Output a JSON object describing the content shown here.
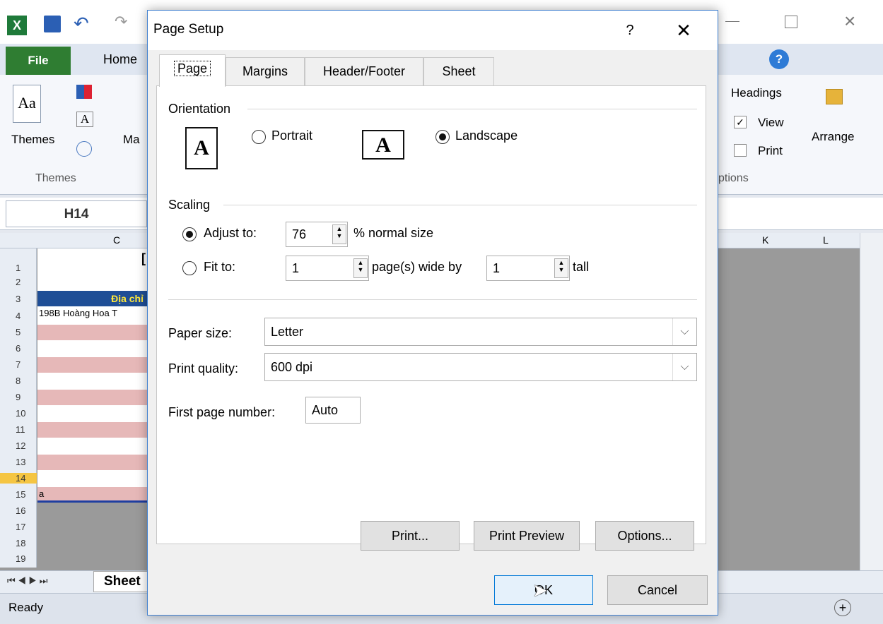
{
  "excel": {
    "file_tab": "File",
    "home_tab": "Home",
    "themes_button": "Themes",
    "themes_group": "Themes",
    "margins_partial": "Ma",
    "name_box": "H14",
    "col_c": "C",
    "col_k": "K",
    "col_l": "L",
    "cell_c1_partial": "[",
    "header_cell": "Địa chỉ",
    "cell_c4": "198B Hoàng Hoa T",
    "cell_c15_partial": "a",
    "rows": [
      "1",
      "2",
      "3",
      "4",
      "5",
      "6",
      "7",
      "8",
      "9",
      "10",
      "11",
      "12",
      "13",
      "14",
      "15",
      "16",
      "17",
      "18",
      "19"
    ],
    "sheet_tab": "Sheet",
    "status": "Ready",
    "headings_label": "Headings",
    "view_label": "View",
    "print_label": "Print",
    "options_partial": "ptions",
    "arrange_label": "Arrange"
  },
  "dialog": {
    "title": "Page Setup",
    "help": "?",
    "close": "✕",
    "tabs": [
      "Page",
      "Margins",
      "Header/Footer",
      "Sheet"
    ],
    "orientation": {
      "label": "Orientation",
      "portrait": "Portrait",
      "landscape": "Landscape",
      "selected": "Landscape",
      "icon_letter": "A"
    },
    "scaling": {
      "label": "Scaling",
      "adjust_to": "Adjust to:",
      "adjust_value": "76",
      "normal_size": "% normal size",
      "fit_to": "Fit to:",
      "fit_wide": "1",
      "wide_by": "page(s) wide by",
      "fit_tall": "1",
      "tall": "tall",
      "selected": "Adjust to:"
    },
    "paper_size_label": "Paper size:",
    "paper_size_value": "Letter",
    "print_quality_label": "Print quality:",
    "print_quality_value": "600 dpi",
    "first_page_label": "First page number:",
    "first_page_value": "Auto",
    "print_button": "Print...",
    "print_preview_button": "Print Preview",
    "options_button": "Options...",
    "ok_button": "OK",
    "cancel_button": "Cancel"
  }
}
